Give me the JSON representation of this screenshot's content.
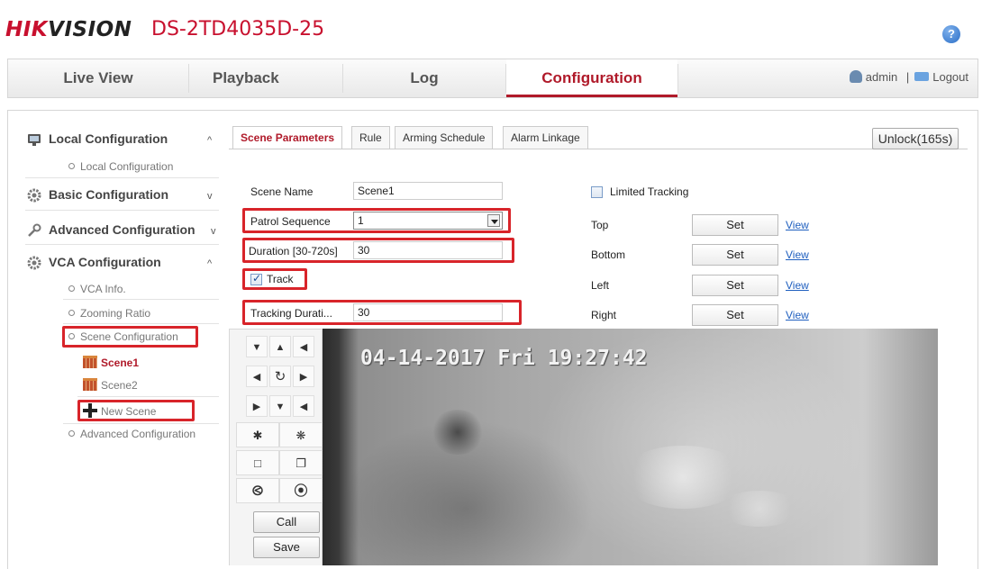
{
  "header": {
    "brand_part1": "HIK",
    "brand_part2": "VISION",
    "model": "DS-2TD4035D-25",
    "help_label": "?"
  },
  "nav": {
    "tabs": [
      "Live View",
      "Playback",
      "Log",
      "Configuration"
    ],
    "active": "Configuration",
    "user": "admin",
    "separator": "|",
    "logout": "Logout"
  },
  "sidebar": {
    "sections": [
      {
        "label": "Local Configuration",
        "chevron": "^",
        "icon": "monitor-icon"
      },
      {
        "label": "Basic Configuration",
        "chevron": "v",
        "icon": "gear-icon"
      },
      {
        "label": "Advanced Configuration",
        "chevron": "v",
        "icon": "wrench-icon"
      },
      {
        "label": "VCA Configuration",
        "chevron": "^",
        "icon": "gear-icon"
      }
    ],
    "local_sub": "Local Configuration",
    "vca_sub": [
      "VCA Info.",
      "Zooming Ratio",
      "Scene Configuration",
      "Advanced Configuration"
    ],
    "scenes": [
      "Scene1",
      "Scene2"
    ],
    "new_scene": "New Scene"
  },
  "subtabs": {
    "items": [
      "Scene Parameters",
      "Rule",
      "Arming Schedule",
      "Alarm Linkage"
    ],
    "active": "Scene Parameters",
    "unlock": "Unlock(165s)"
  },
  "form": {
    "scene_name_label": "Scene Name",
    "scene_name_value": "Scene1",
    "patrol_label": "Patrol Sequence",
    "patrol_value": "1",
    "duration_label": "Duration [30-720s]",
    "duration_value": "30",
    "track_label": "Track",
    "track_checked": true,
    "tracking_duration_label": "Tracking Durati...",
    "tracking_duration_value": "30",
    "limited_tracking_label": "Limited Tracking",
    "limited_tracking_checked": false
  },
  "limits": [
    {
      "label": "Top",
      "button": "Set",
      "link": "View"
    },
    {
      "label": "Bottom",
      "button": "Set",
      "link": "View"
    },
    {
      "label": "Left",
      "button": "Set",
      "link": "View"
    },
    {
      "label": "Right",
      "button": "Set",
      "link": "View"
    }
  ],
  "ptz": {
    "call": "Call",
    "save": "Save"
  },
  "video": {
    "osd": "04-14-2017 Fri 19:27:42"
  },
  "colors": {
    "brand_red": "#c8102e",
    "highlight_box": "#d8242a",
    "link_blue": "#1f5fbf"
  }
}
